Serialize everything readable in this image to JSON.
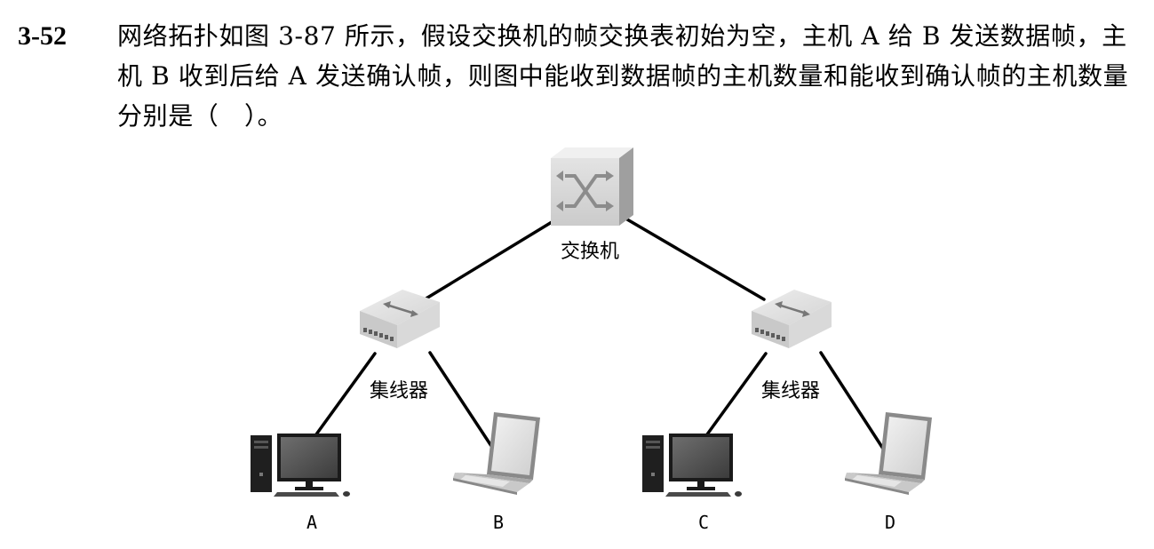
{
  "question": {
    "number": "3-52",
    "text": "网络拓扑如图 3-87 所示，假设交换机的帧交换表初始为空，主机 A 给 B 发送数据帧，主机 B 收到后给 A 发送确认帧，则图中能收到数据帧的主机数量和能收到确认帧的主机数量分别是（　）。"
  },
  "diagram": {
    "switch": {
      "label": "交换机",
      "icon": "network-switch-icon"
    },
    "hubs": [
      {
        "label": "集线器",
        "icon": "hub-icon"
      },
      {
        "label": "集线器",
        "icon": "hub-icon"
      }
    ],
    "hosts": [
      {
        "label": "A",
        "icon": "desktop-computer-icon"
      },
      {
        "label": "B",
        "icon": "laptop-icon"
      },
      {
        "label": "C",
        "icon": "desktop-computer-icon"
      },
      {
        "label": "D",
        "icon": "laptop-icon"
      }
    ]
  }
}
